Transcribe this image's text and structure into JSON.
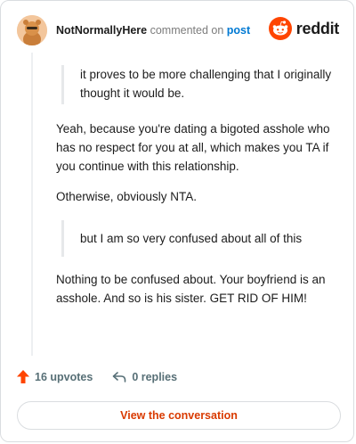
{
  "header": {
    "username": "NotNormallyHere",
    "action_text": "commented on",
    "post_link_label": "post",
    "logo_text": "reddit"
  },
  "comment": {
    "quote1": "it proves to be more challenging that I originally thought it would be.",
    "para1": "Yeah, because you're dating a bigoted asshole who has no respect for you at all, which makes you TA if you continue with this relationship.",
    "para2": "Otherwise, obviously NTA.",
    "quote2": "but I am so very confused about all of this",
    "para3": "Nothing to be confused about. Your boyfriend is an asshole. And so is his sister. GET RID OF HIM!"
  },
  "actions": {
    "upvotes_label": "16 upvotes",
    "replies_label": "0 replies"
  },
  "footer": {
    "view_conversation_label": "View the conversation"
  },
  "colors": {
    "upvote_orange": "#ff4500",
    "reddit_orange": "#ff4500",
    "link_blue": "#0079d3",
    "button_text": "#d93a00"
  }
}
